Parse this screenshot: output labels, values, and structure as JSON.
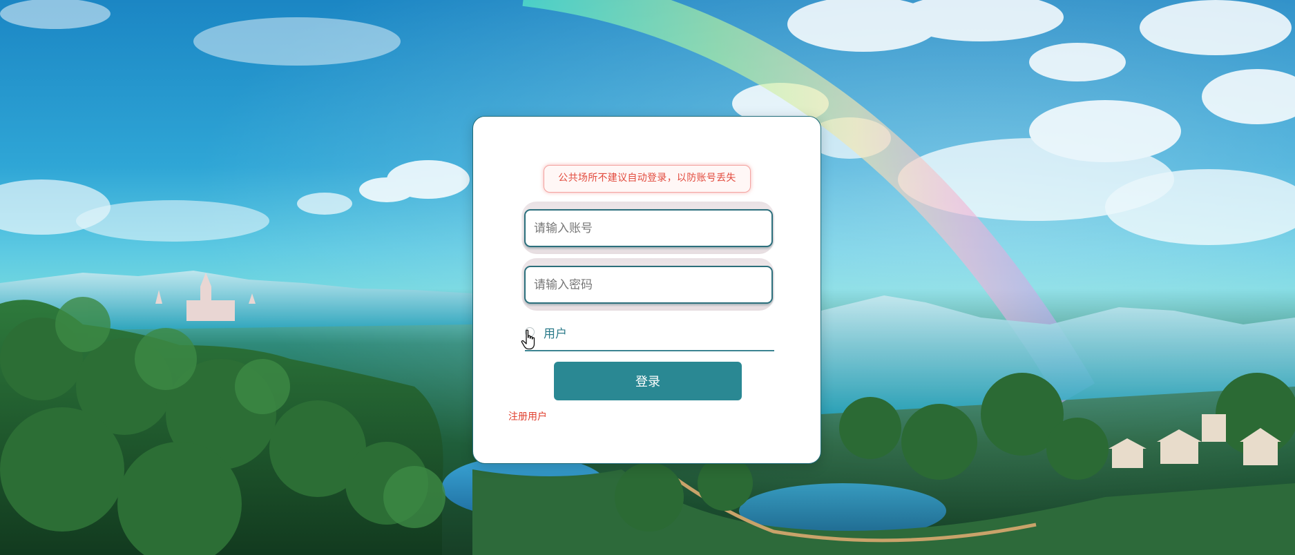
{
  "notice": {
    "text": "公共场所不建议自动登录，以防账号丢失"
  },
  "account": {
    "placeholder": "请输入账号"
  },
  "password": {
    "placeholder": "请输入密码"
  },
  "role": {
    "label": "用户"
  },
  "login_button": {
    "label": "登录"
  },
  "register_link": {
    "label": "注册用户"
  },
  "colors": {
    "accent": "#2a8893",
    "notice_text": "#e24b3e",
    "link": "#e0402f",
    "card_border": "#1c6a78"
  }
}
